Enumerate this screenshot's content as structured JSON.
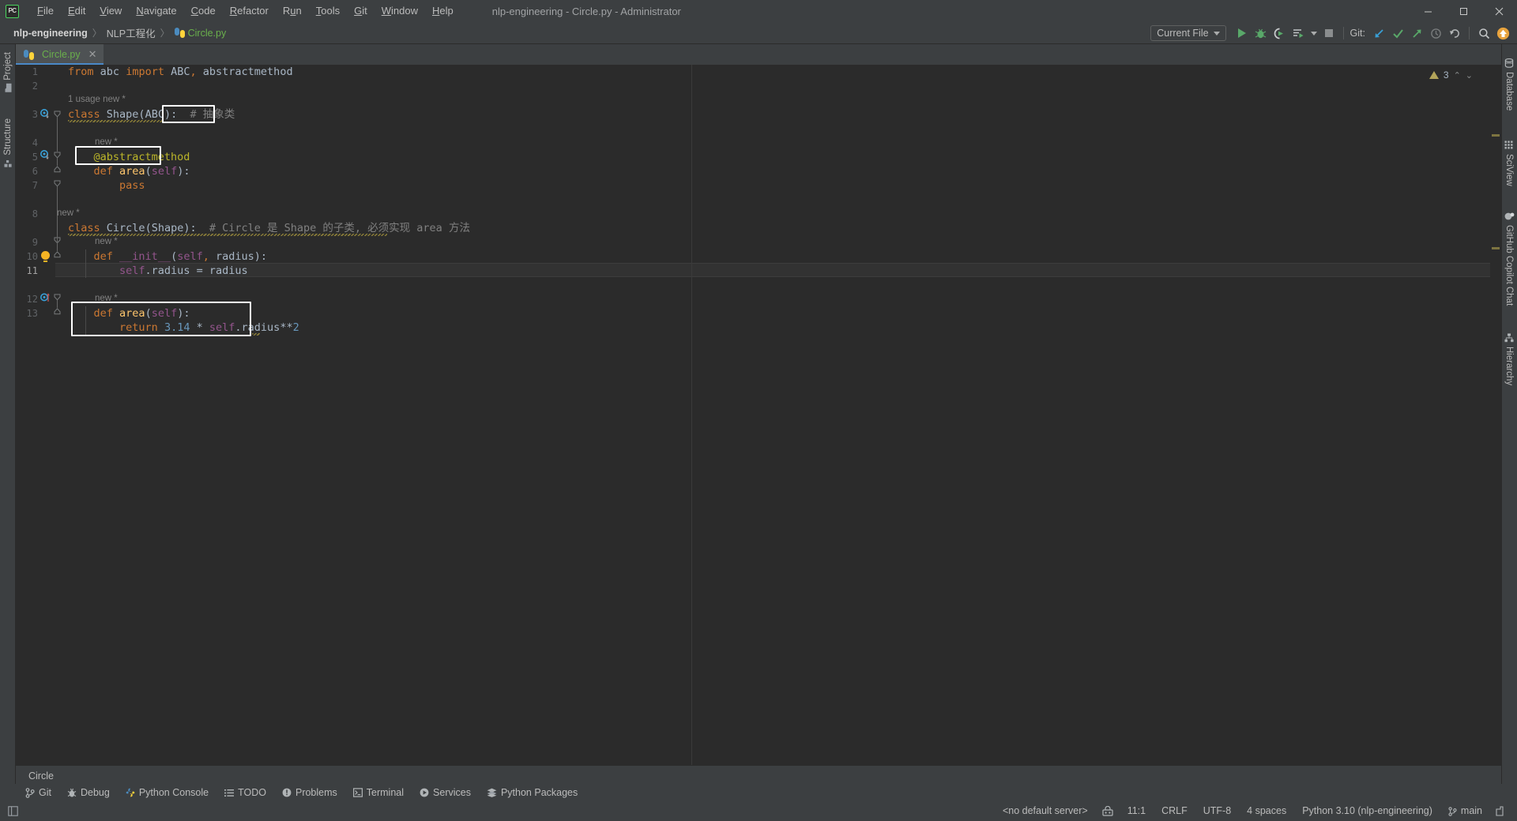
{
  "window": {
    "title": "nlp-engineering - Circle.py - Administrator",
    "app_logo": "PC",
    "controls": {
      "minimize": "–",
      "maximize": "▢",
      "close": "✕"
    }
  },
  "menu": {
    "items": [
      {
        "label": "File"
      },
      {
        "label": "Edit"
      },
      {
        "label": "View"
      },
      {
        "label": "Navigate"
      },
      {
        "label": "Code"
      },
      {
        "label": "Refactor"
      },
      {
        "label": "Run"
      },
      {
        "label": "Tools"
      },
      {
        "label": "Git"
      },
      {
        "label": "Window"
      },
      {
        "label": "Help"
      }
    ]
  },
  "breadcrumb": {
    "items": [
      "nlp-engineering",
      "NLP工程化",
      "Circle.py"
    ],
    "separator": "〉"
  },
  "run_toolbar": {
    "config_label": "Current File",
    "git_label": "Git:",
    "buttons": [
      {
        "name": "run-button",
        "glyph": "▶"
      },
      {
        "name": "debug-button",
        "glyph": "🐞"
      },
      {
        "name": "run-with-coverage-button",
        "glyph": "◐"
      },
      {
        "name": "profile-button",
        "glyph": "≡▶"
      },
      {
        "name": "stop-button",
        "glyph": "■"
      },
      {
        "name": "git-update-project-button",
        "glyph": "↙"
      },
      {
        "name": "git-commit-button",
        "glyph": "✓"
      },
      {
        "name": "git-push-button",
        "glyph": "↗"
      },
      {
        "name": "git-history-button",
        "glyph": "◷"
      },
      {
        "name": "git-rollback-button",
        "glyph": "↺"
      },
      {
        "name": "search-everywhere-button",
        "glyph": "🔍"
      },
      {
        "name": "updates-available-button",
        "glyph": "↑"
      }
    ]
  },
  "left_tool_strip": {
    "items": [
      {
        "label": "Project",
        "icon": "folder-icon"
      },
      {
        "label": "Structure",
        "icon": "structure-icon"
      }
    ]
  },
  "right_tool_strip": {
    "items": [
      {
        "label": "Database",
        "icon": "database-icon"
      },
      {
        "label": "SciView",
        "icon": "sciview-icon"
      },
      {
        "label": "GitHub Copilot Chat",
        "icon": "copilot-icon"
      },
      {
        "label": "Hierarchy",
        "icon": "hierarchy-icon"
      }
    ]
  },
  "editor": {
    "tab": {
      "label": "Circle.py",
      "icon": "python-file-icon",
      "close": "✕"
    },
    "inspection": {
      "count": "3",
      "icon": "warning-triangle-icon",
      "up": "⌃",
      "down": "⌄"
    },
    "breadcrumb_bottom": "Circle",
    "lines": [
      {
        "num": "1",
        "text": "from abc import ABC, abstractmethod"
      },
      {
        "num": "2",
        "text": ""
      },
      {
        "num": "",
        "hint": "1 usage   new *"
      },
      {
        "num": "3",
        "text": "class Shape(ABC):  # 抽象类"
      },
      {
        "num": "",
        "hint": "new *"
      },
      {
        "num": "4",
        "text": "    @abstractmethod"
      },
      {
        "num": "5",
        "text": "    def area(self):"
      },
      {
        "num": "6",
        "text": "        pass"
      },
      {
        "num": "7",
        "text": ""
      },
      {
        "num": "",
        "hint": "new *"
      },
      {
        "num": "8",
        "text": "class Circle(Shape):  # Circle 是 Shape 的子类, 必须实现 area 方法"
      },
      {
        "num": "",
        "hint": "new *"
      },
      {
        "num": "9",
        "text": "    def __init__(self, radius):"
      },
      {
        "num": "10",
        "text": "        self.radius = radius"
      },
      {
        "num": "11",
        "text": ""
      },
      {
        "num": "",
        "hint": "new *"
      },
      {
        "num": "12",
        "text": "    def area(self):"
      },
      {
        "num": "13",
        "text": "        return 3.14 * self.radius**2"
      }
    ],
    "hints": {
      "usage_line3": "1 usage",
      "new_marker": "new *"
    },
    "highlight_boxes": [
      {
        "name": "comment-abstract-class-highlight",
        "label": "# 抽象类"
      },
      {
        "name": "abstractmethod-decorator-highlight",
        "label": "@abstractmethod"
      },
      {
        "name": "area-override-method-highlight",
        "label": "def area(self): return 3.14 * self.radius**2"
      }
    ]
  },
  "bottom_tools": [
    {
      "label": "Git",
      "icon": "git-branch-icon"
    },
    {
      "label": "Debug",
      "icon": "debug-bug-icon"
    },
    {
      "label": "Python Console",
      "icon": "python-console-icon"
    },
    {
      "label": "TODO",
      "icon": "todo-list-icon"
    },
    {
      "label": "Problems",
      "icon": "problems-icon"
    },
    {
      "label": "Terminal",
      "icon": "terminal-icon"
    },
    {
      "label": "Services",
      "icon": "services-icon"
    },
    {
      "label": "Python Packages",
      "icon": "packages-icon"
    }
  ],
  "status_bar": {
    "left_icon": "show-tool-windows-icon",
    "items": [
      {
        "name": "default-server",
        "label": "<no default server>"
      },
      {
        "name": "database-inspection-icon",
        "label": ""
      },
      {
        "name": "caret-position",
        "label": "11:1"
      },
      {
        "name": "line-separator",
        "label": "CRLF"
      },
      {
        "name": "file-encoding",
        "label": "UTF-8"
      },
      {
        "name": "indent-size",
        "label": "4 spaces"
      },
      {
        "name": "python-interpreter",
        "label": "Python 3.10 (nlp-engineering)"
      },
      {
        "name": "git-branch",
        "label": "main"
      }
    ]
  },
  "colors": {
    "chrome": "#3c3f41",
    "editor_bg": "#2b2b2b",
    "accent_blue": "#4a88c7",
    "green": "#6ab04c",
    "keyword": "#cc7832",
    "function": "#ffc66d",
    "self": "#94558d",
    "number": "#6897bb",
    "comment": "#808080",
    "decorator": "#bbb529",
    "text": "#a9b7c6"
  }
}
